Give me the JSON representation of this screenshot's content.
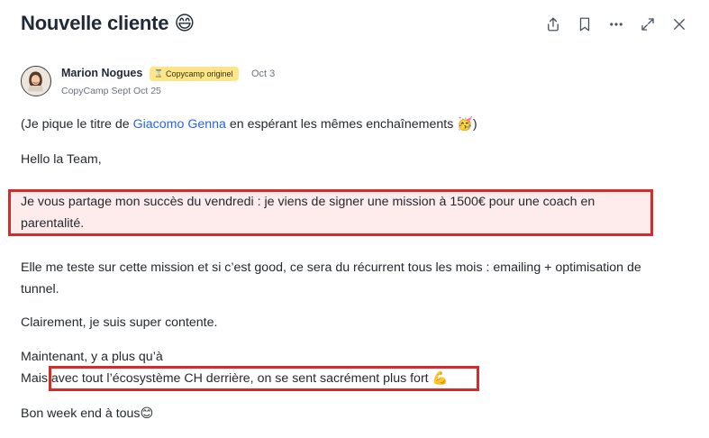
{
  "post": {
    "title": "Nouvelle cliente",
    "title_emoji": "😄",
    "author": {
      "name": "Marion Nogues",
      "badge": "Copycamp originel",
      "date": "Oct 3",
      "subtitle": "CopyCamp Sept Oct 25"
    },
    "body": {
      "intro_prefix": "(Je pique le titre de ",
      "intro_link": "Giacomo Genna",
      "intro_suffix": " en espérant les mêmes enchaînements ",
      "intro_emoji": "🥳",
      "intro_close": ")",
      "greeting": "Hello la Team,",
      "highlight": "Je vous partage mon succès du vendredi : je viens de signer une mission à 1500€ pour une coach en parentalité.",
      "para2_line1": "Elle me teste sur cette mission et si c’est good, ce sera du récurrent tous les mois : emailing + optimisation de",
      "para2_line2": "tunnel.",
      "para3": "Clairement, je suis super contente.",
      "para4_line1": "Maintenant, y a plus qu’à",
      "para4_line2_prefix": "Mais ",
      "para4_line2_highlight": "avec tout l’écosystème CH derrière, on se sent sacrément plus fort ",
      "para4_emoji": "💪",
      "closing": "Bon week end à tous",
      "closing_emoji": "😊"
    }
  },
  "toolbar": {
    "share_icon": "share-icon",
    "bookmark_icon": "bookmark-icon",
    "more_icon": "more-icon",
    "expand_icon": "expand-icon",
    "close_icon": "close-icon"
  },
  "colors": {
    "link": "#2563eb",
    "badge_bg": "#fde68a",
    "highlight_border": "#d62b2b",
    "highlight_bg": "#fdeceb"
  }
}
